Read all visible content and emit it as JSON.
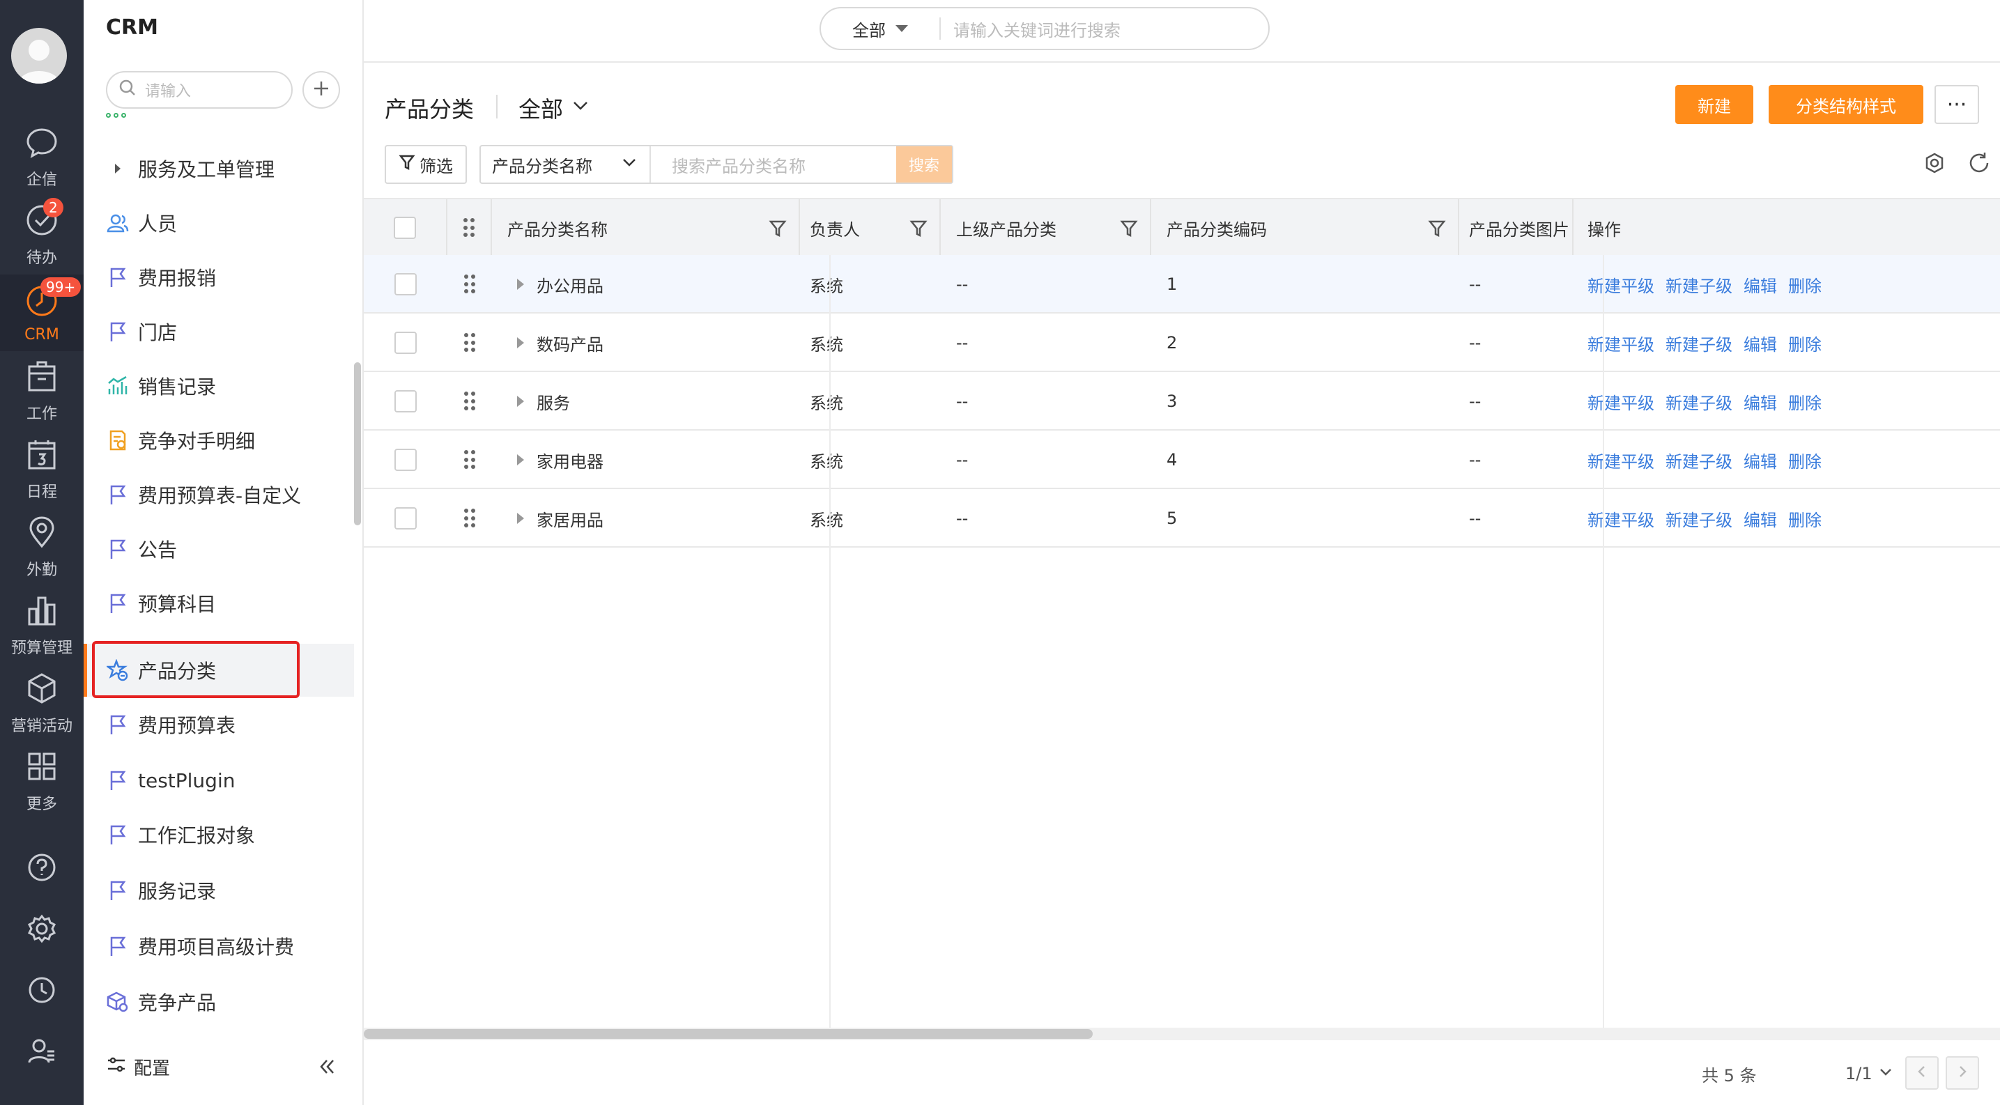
{
  "rail": {
    "items": [
      {
        "label": "企信",
        "icon": "chat-icon"
      },
      {
        "label": "待办",
        "icon": "todo-check-icon",
        "badge": "2"
      },
      {
        "label": "CRM",
        "icon": "crm-icon",
        "badge": "99+"
      },
      {
        "label": "工作",
        "icon": "briefcase-icon"
      },
      {
        "label": "日程",
        "icon": "calendar-icon"
      },
      {
        "label": "外勤",
        "icon": "location-icon"
      },
      {
        "label": "预算管理",
        "icon": "bar-chart-icon"
      },
      {
        "label": "营销活动",
        "icon": "cube-icon"
      },
      {
        "label": "更多",
        "icon": "grid-icon"
      }
    ],
    "bottom_icons": [
      "help-icon",
      "settings-icon",
      "history-icon",
      "user-manage-icon"
    ]
  },
  "sidebar": {
    "title": "CRM",
    "search_placeholder": "请输入",
    "items": [
      {
        "label": "服务及工单管理",
        "icon": "caret-right-icon"
      },
      {
        "label": "人员",
        "icon": "people-icon"
      },
      {
        "label": "费用报销",
        "icon": "flag-icon"
      },
      {
        "label": "门店",
        "icon": "flag-icon"
      },
      {
        "label": "销售记录",
        "icon": "sales-chart-icon"
      },
      {
        "label": "竞争对手明细",
        "icon": "document-icon"
      },
      {
        "label": "费用预算表-自定义",
        "icon": "flag-icon"
      },
      {
        "label": "公告",
        "icon": "flag-icon"
      },
      {
        "label": "预算科目",
        "icon": "flag-icon"
      },
      {
        "label": "产品分类",
        "icon": "star-category-icon",
        "selected": true
      },
      {
        "label": "费用预算表",
        "icon": "flag-icon"
      },
      {
        "label": "testPlugin",
        "icon": "flag-icon"
      },
      {
        "label": "工作汇报对象",
        "icon": "flag-icon"
      },
      {
        "label": "服务记录",
        "icon": "flag-icon"
      },
      {
        "label": "费用项目高级计费",
        "icon": "flag-icon"
      },
      {
        "label": "竞争产品",
        "icon": "product-box-icon"
      }
    ],
    "footer_label": "配置"
  },
  "topbar": {
    "scope": "全部",
    "search_placeholder": "请输入关键词进行搜索"
  },
  "main": {
    "title": "产品分类",
    "view": "全部",
    "new_button": "新建",
    "structure_button": "分类结构样式",
    "more_button": "···",
    "filter_button": "筛选",
    "search_field": "产品分类名称",
    "search_placeholder": "搜索产品分类名称",
    "search_button": "搜索"
  },
  "table": {
    "columns": [
      "产品分类名称",
      "负责人",
      "上级产品分类",
      "产品分类编码",
      "产品分类图片",
      "操作"
    ],
    "rows": [
      {
        "name": "办公用品",
        "owner": "系统",
        "parent": "--",
        "code": "1",
        "image": "--"
      },
      {
        "name": "数码产品",
        "owner": "系统",
        "parent": "--",
        "code": "2",
        "image": "--"
      },
      {
        "name": "服务",
        "owner": "系统",
        "parent": "--",
        "code": "3",
        "image": "--"
      },
      {
        "name": "家用电器",
        "owner": "系统",
        "parent": "--",
        "code": "4",
        "image": "--"
      },
      {
        "name": "家居用品",
        "owner": "系统",
        "parent": "--",
        "code": "5",
        "image": "--"
      }
    ],
    "actions": [
      "新建平级",
      "新建子级",
      "编辑",
      "删除"
    ]
  },
  "pagination": {
    "total": "共 5 条",
    "page": "1/1"
  },
  "colors": {
    "accent": "#ff8c1a",
    "link": "#3b7ddd",
    "rail_bg": "#2a2f3b",
    "badge": "#f5533d",
    "highlight": "#e52222"
  }
}
